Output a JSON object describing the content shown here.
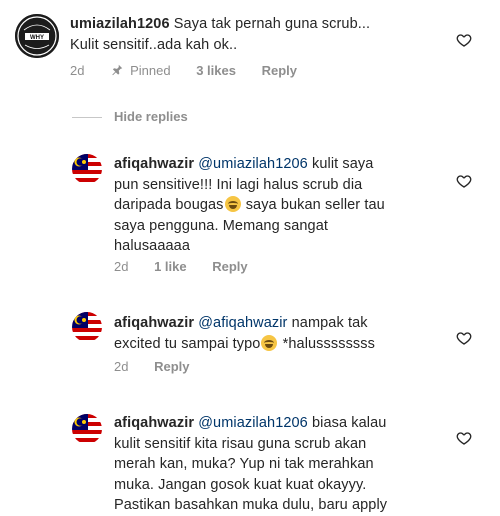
{
  "main_comment": {
    "username": "umiazilah1206",
    "text_line1": "Saya tak pernah guna scrub...",
    "text_line2": "Kulit sensitif..ada kah ok..",
    "time": "2d",
    "pinned_label": "Pinned",
    "likes": "3 likes",
    "reply_label": "Reply",
    "avatar_text": "Somewhere WHY Stories",
    "avatar_icon": "profile-logo-icon"
  },
  "hide_replies_label": "Hide replies",
  "replies": [
    {
      "username": "afiqahwazir",
      "mention": "@umiazilah1206",
      "lines": [
        "kulit saya",
        "pun sensitive!!! Ini lagi halus scrub dia",
        "daripada bougas",
        "saya bukan seller tau",
        "saya pengguna. Memang sangat",
        "halusaaaaa"
      ],
      "time": "2d",
      "likes": "1 like",
      "reply_label": "Reply"
    },
    {
      "username": "afiqahwazir",
      "mention": "@afiqahwazir",
      "lines": [
        "nampak tak",
        "excited tu sampai typo",
        "*halussssssss"
      ],
      "time": "2d",
      "reply_label": "Reply"
    },
    {
      "username": "afiqahwazir",
      "mention": "@umiazilah1206",
      "lines": [
        "biasa kalau",
        "kulit sensitif kita risau guna scrub akan",
        "merah kan, muka? Yup ni tak merahkan",
        "muka. Jangan gosok kuat kuat okayyy.",
        "Pastikan basahkan muka dulu, baru apply"
      ]
    }
  ],
  "colors": {
    "text": "#262626",
    "muted": "#8e8e8e",
    "mention": "#003569"
  }
}
